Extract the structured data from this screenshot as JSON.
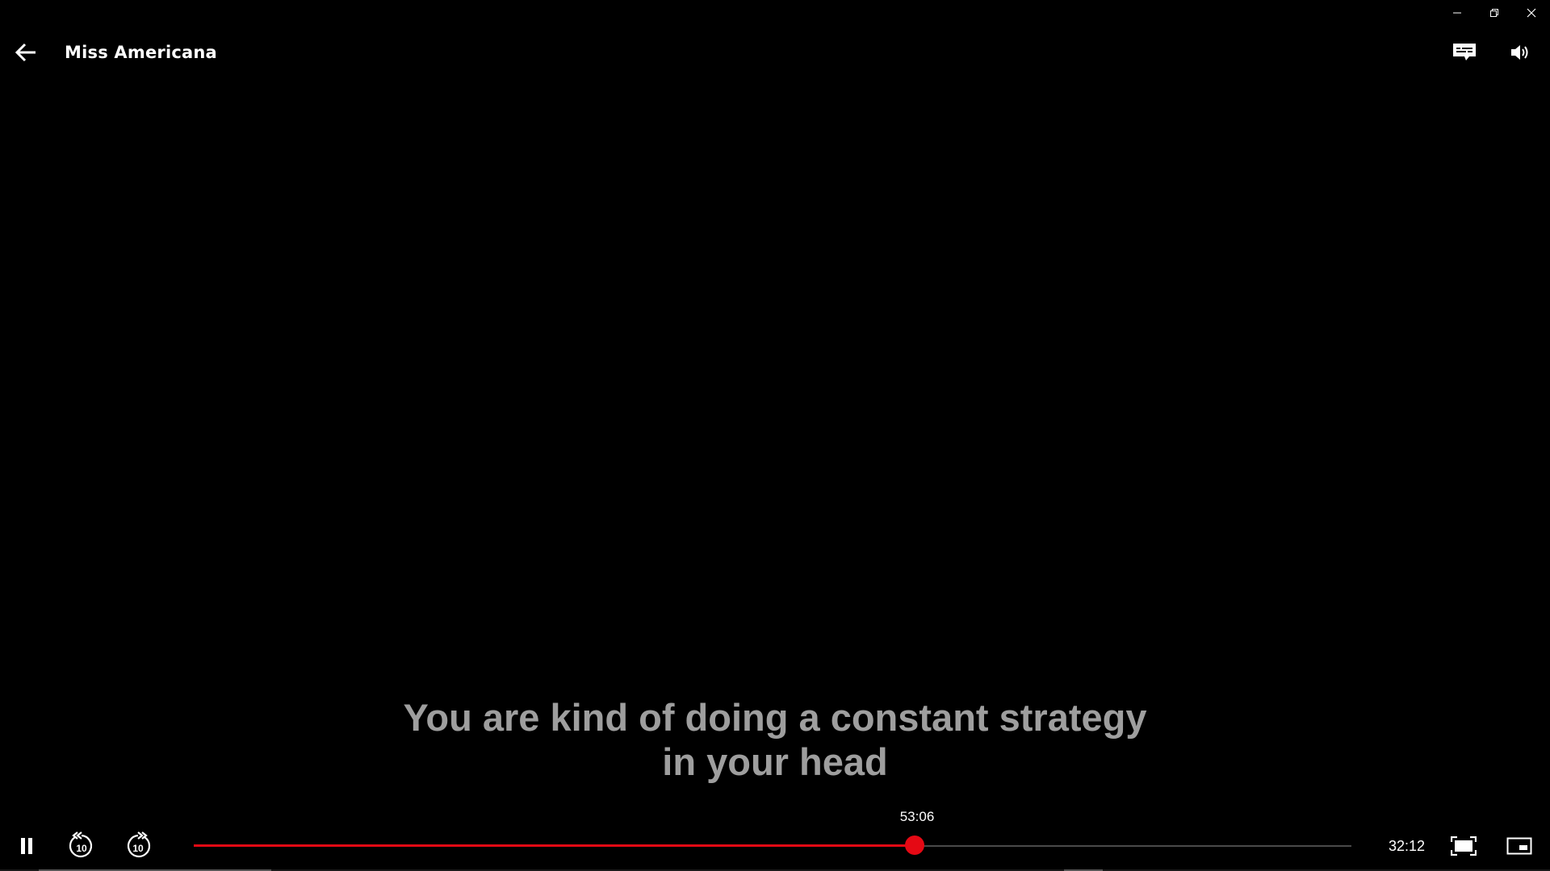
{
  "window": {
    "minimize_icon": "minimize-icon",
    "restore_icon": "restore-icon",
    "close_icon": "close-icon"
  },
  "header": {
    "back_icon": "arrow-left-icon",
    "title": "Miss Americana",
    "subtitles_icon": "subtitles-icon",
    "volume_icon": "volume-icon"
  },
  "subtitle": {
    "line1": "You are kind of doing a constant strategy",
    "line2": "in your head"
  },
  "player": {
    "state": "playing",
    "seek_time": "53:06",
    "progress_fraction": 0.623,
    "remaining_time": "32:12",
    "rewind_seconds": "10",
    "forward_seconds": "10"
  },
  "colors": {
    "accent": "#e50914",
    "background": "#000000",
    "subtitle": "#9e9e9e"
  }
}
